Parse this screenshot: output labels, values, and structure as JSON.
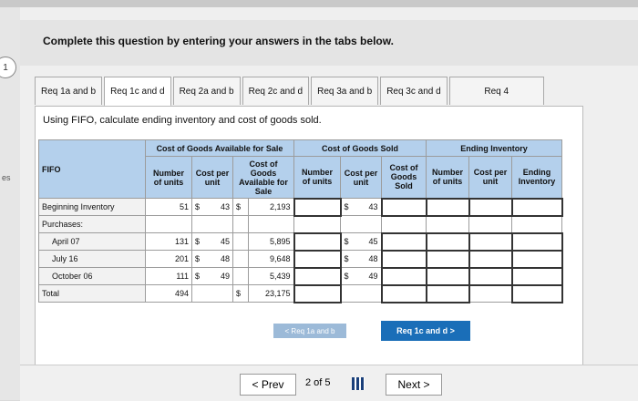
{
  "instruction": "Complete this question by entering your answers in the tabs below.",
  "question_number": "1",
  "side_label": "es",
  "tabs": [
    "Req 1a and b",
    "Req 1c and d",
    "Req 2a and b",
    "Req 2c and d",
    "Req 3a and b",
    "Req 3c and d",
    "Req 4"
  ],
  "subquestion": "Using FIFO, calculate ending inventory and cost of goods sold.",
  "table": {
    "row_header": "FIFO",
    "group_headers": [
      "Cost of Goods Available for Sale",
      "Cost of Goods Sold",
      "Ending Inventory"
    ],
    "col_headers": [
      "Number of units",
      "Cost per unit",
      "Cost of Goods Available for Sale",
      "Number of units",
      "Cost per unit",
      "Cost of Goods Sold",
      "Number of units",
      "Cost per unit",
      "Ending Inventory"
    ],
    "rows": [
      {
        "label": "Beginning Inventory",
        "units": "51",
        "cur1": "$",
        "cost": "43",
        "cur2": "$",
        "avail": "2,193",
        "sold_cur": "$",
        "sold_cost": "43"
      },
      {
        "label": "Purchases:",
        "units": "",
        "cur1": "",
        "cost": "",
        "cur2": "",
        "avail": "",
        "sold_cur": "",
        "sold_cost": ""
      },
      {
        "label": "April 07",
        "units": "131",
        "cur1": "$",
        "cost": "45",
        "cur2": "",
        "avail": "5,895",
        "sold_cur": "$",
        "sold_cost": "45"
      },
      {
        "label": "July 16",
        "units": "201",
        "cur1": "$",
        "cost": "48",
        "cur2": "",
        "avail": "9,648",
        "sold_cur": "$",
        "sold_cost": "48"
      },
      {
        "label": "October 06",
        "units": "111",
        "cur1": "$",
        "cost": "49",
        "cur2": "",
        "avail": "5,439",
        "sold_cur": "$",
        "sold_cost": "49"
      },
      {
        "label": "Total",
        "units": "494",
        "cur1": "",
        "cost": "",
        "cur2": "$",
        "avail": "23,175",
        "sold_cur": "",
        "sold_cost": ""
      }
    ]
  },
  "nav": {
    "prev_small": "< Req 1a and b",
    "next_small": "Req 1c and d  >",
    "prev": "< Prev",
    "page": "2 of 5",
    "next": "Next >"
  }
}
